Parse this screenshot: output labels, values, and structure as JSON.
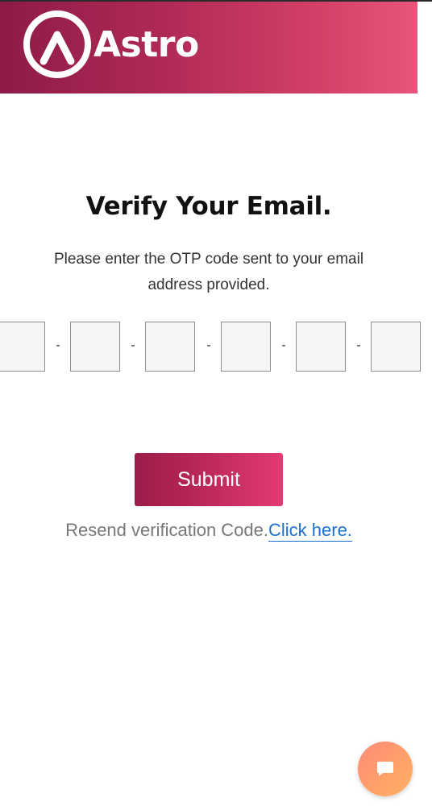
{
  "header": {
    "brand": "Astro",
    "logo_icon": "astro-logo-icon",
    "colors": {
      "gradient_start": "#8e1a48",
      "gradient_end": "#e9557a"
    }
  },
  "verify": {
    "title": "Verify Your Email.",
    "subtitle": "Please enter the OTP code sent to your email address provided.",
    "otp_fields": [
      "",
      "",
      "",
      "",
      "",
      ""
    ],
    "separator": "-",
    "submit_label": "Submit",
    "resend_text": "Resend verification Code.",
    "resend_link": "Click here."
  },
  "chat": {
    "icon": "chat-bubble-icon",
    "colors": {
      "start": "#ff8a7a",
      "end": "#ffb265"
    }
  }
}
